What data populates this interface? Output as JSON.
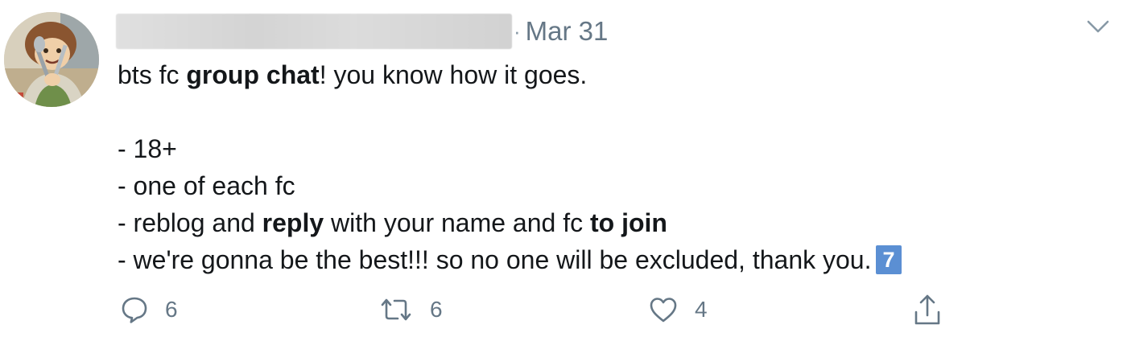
{
  "tweet": {
    "author_name_redacted": true,
    "separator": "·",
    "date": "Mar 31",
    "text": {
      "line1_a": "bts fc ",
      "line1_b": "group chat",
      "line1_c": "! you know how it goes.",
      "bullet1": "- 18+",
      "bullet2": "- one of each fc",
      "bullet3_a": "- reblog and ",
      "bullet3_b": "reply",
      "bullet3_c": " with your name and fc ",
      "bullet3_d": "to join",
      "bullet4": "- we're gonna be the best!!! so no one will be excluded, thank you.",
      "badge": "7"
    },
    "actions": {
      "reply_count": "6",
      "retweet_count": "6",
      "like_count": "4"
    },
    "icons": {
      "reply": "speech-bubble-icon",
      "retweet": "retweet-icon",
      "like": "heart-icon",
      "share": "share-icon",
      "menu": "chevron-down-icon"
    },
    "colors": {
      "secondary_text": "#657786",
      "primary_text": "#14171a",
      "badge_bg": "#5b8fd3"
    }
  }
}
